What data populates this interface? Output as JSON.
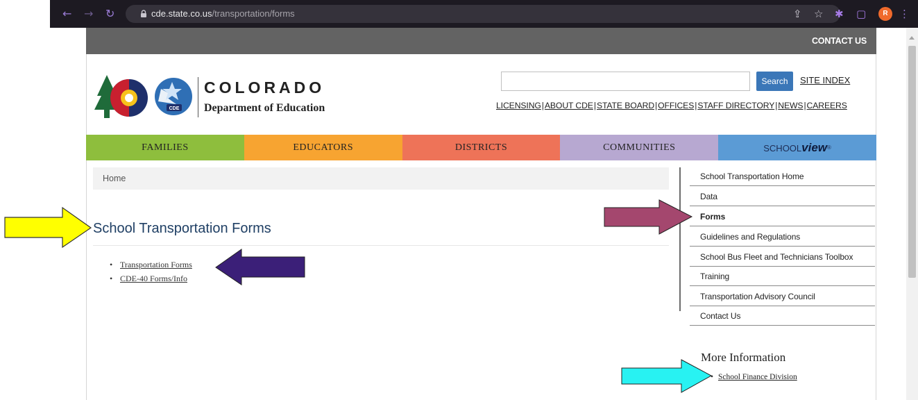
{
  "browser": {
    "url_host": "cde.state.co.us",
    "url_path": "/transportation/forms",
    "avatar_letter": "R"
  },
  "header": {
    "contact_us": "CONTACT US",
    "org_name": "COLORADO",
    "org_dept": "Department of Education",
    "search_placeholder": "",
    "search_button": "Search",
    "site_index": "SITE INDEX",
    "util_links": [
      "LICENSING",
      "ABOUT CDE",
      "STATE BOARD",
      "OFFICES",
      "STAFF DIRECTORY",
      "NEWS",
      "CAREERS"
    ]
  },
  "main_nav": {
    "families": "FAMILIES",
    "educators": "EDUCATORS",
    "districts": "DISTRICTS",
    "communities": "COMMUNITIES",
    "schoolview_a": "SCHOOL",
    "schoolview_b": "view",
    "schoolview_reg": "®"
  },
  "breadcrumb": {
    "home": "Home"
  },
  "main": {
    "title": "School Transportation Forms",
    "links": [
      "Transportation Forms",
      "CDE-40 Forms/Info"
    ]
  },
  "sidebar": {
    "items": [
      "School Transportation Home",
      "Data",
      "Forms",
      "Guidelines and Regulations",
      "School Bus Fleet and Technicians Toolbox",
      "Training",
      "Transportation Advisory Council",
      "Contact Us"
    ],
    "active_index": 2,
    "more_info_heading": "More Information",
    "more_info_links": [
      "School Finance Division"
    ]
  },
  "annotation_colors": {
    "yellow_arrow": "#ffff00",
    "purple_arrow": "#3b1f78",
    "mauve_arrow": "#a4476e",
    "cyan_arrow": "#28f2f2"
  }
}
